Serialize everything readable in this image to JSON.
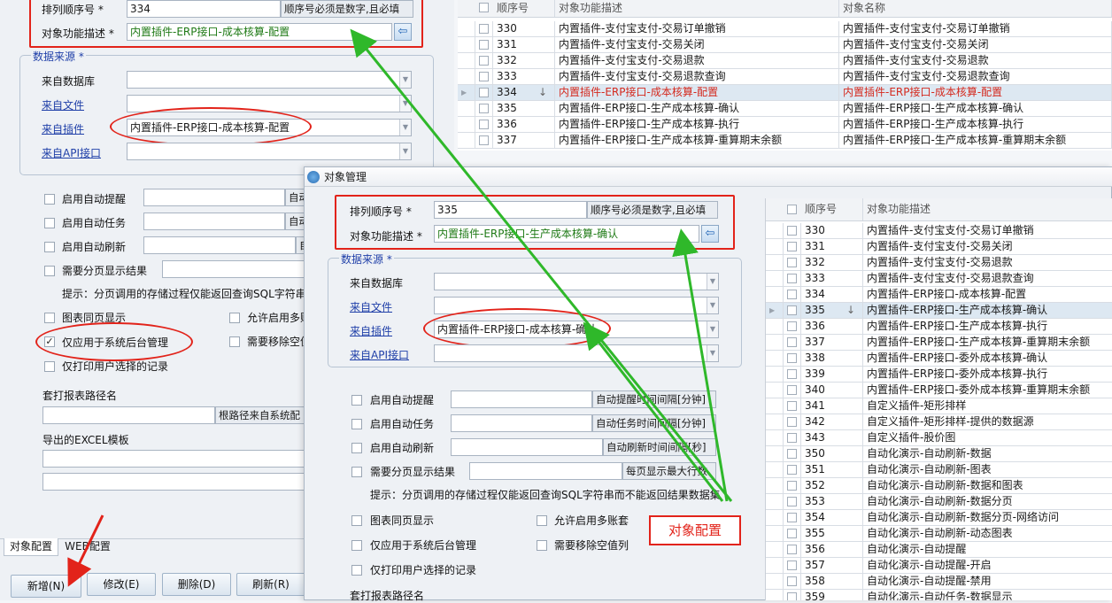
{
  "bg": {
    "order_label": "排列顺序号",
    "order_value": "334",
    "order_note": "顺序号必须是数字,且必填",
    "desc_label": "对象功能描述",
    "desc_value": "内置插件-ERP接口-成本核算-配置",
    "datasource_title": "数据来源",
    "from_db": "来自数据库",
    "from_file": "来自文件",
    "from_plugin": "来自插件",
    "plugin_value": "内置插件-ERP接口-成本核算-配置",
    "from_api": "来自API接口",
    "auto_remind": "启用自动提醒",
    "auto_remind_note": "自动",
    "auto_task": "启用自动任务",
    "auto_task_note": "自动",
    "auto_refresh": "启用自动刷新",
    "auto_refresh_note": "自",
    "paging": "需要分页显示结果",
    "hint": "提示：分页调用的存储过程仅能返回查询SQL字符串i",
    "same_page": "图表同页显示",
    "multi_acct": "允许启用多账",
    "backend_only": "仅应用于系统后台管理",
    "remove_null": "需要移除空值",
    "print_selected": "仅打印用户选择的记录",
    "print_path": "套打报表路径名",
    "root_note": "根路径来自系统配",
    "excel_template": "导出的EXCEL模板",
    "tab_object": "对象配置",
    "tab_web": "WEB配置",
    "btn_add": "新增(N)",
    "btn_edit": "修改(E)",
    "btn_delete": "删除(D)",
    "btn_refresh": "刷新(R)",
    "grid_headers": [
      "顺序号",
      "对象功能描述",
      "对象名称"
    ],
    "grid_rows": [
      [
        "330",
        "内置插件-支付宝支付-交易订单撤销",
        "内置插件-支付宝支付-交易订单撤销"
      ],
      [
        "331",
        "内置插件-支付宝支付-交易关闭",
        "内置插件-支付宝支付-交易关闭"
      ],
      [
        "332",
        "内置插件-支付宝支付-交易退款",
        "内置插件-支付宝支付-交易退款"
      ],
      [
        "333",
        "内置插件-支付宝支付-交易退款查询",
        "内置插件-支付宝支付-交易退款查询"
      ],
      [
        "334",
        "内置插件-ERP接口-成本核算-配置",
        "内置插件-ERP接口-成本核算-配置"
      ],
      [
        "335",
        "内置插件-ERP接口-生产成本核算-确认",
        "内置插件-ERP接口-生产成本核算-确认"
      ],
      [
        "336",
        "内置插件-ERP接口-生产成本核算-执行",
        "内置插件-ERP接口-生产成本核算-执行"
      ],
      [
        "337",
        "内置插件-ERP接口-生产成本核算-重算期末余额",
        "内置插件-ERP接口-生产成本核算-重算期末余额"
      ]
    ]
  },
  "fg": {
    "window_title": "对象管理",
    "order_label": "排列顺序号",
    "order_value": "335",
    "order_note": "顺序号必须是数字,且必填",
    "desc_label": "对象功能描述",
    "desc_value": "内置插件-ERP接口-生产成本核算-确认",
    "datasource_title": "数据来源",
    "from_db": "来自数据库",
    "from_file": "来自文件",
    "from_plugin": "来自插件",
    "plugin_value": "内置插件-ERP接口-成本核算-确认",
    "from_api": "来自API接口",
    "auto_remind": "启用自动提醒",
    "auto_remind_note": "自动提醒时间间隔[分钟]",
    "auto_task": "启用自动任务",
    "auto_task_note": "自动任务时间间隔[分钟]",
    "auto_refresh": "启用自动刷新",
    "auto_refresh_note": "自动刷新时间间隔[秒]",
    "paging": "需要分页显示结果",
    "paging_note": "每页显示最大行数",
    "hint": "提示：分页调用的存储过程仅能返回查询SQL字符串而不能返回结果数据集",
    "same_page": "图表同页显示",
    "multi_acct": "允许启用多账套",
    "backend_only": "仅应用于系统后台管理",
    "remove_null": "需要移除空值列",
    "print_selected": "仅打印用户选择的记录",
    "print_path": "套打报表路径名",
    "callout": "对象配置",
    "grid_headers": [
      "顺序号",
      "对象功能描述"
    ],
    "grid_rows": [
      [
        "330",
        "内置插件-支付宝支付-交易订单撤销"
      ],
      [
        "331",
        "内置插件-支付宝支付-交易关闭"
      ],
      [
        "332",
        "内置插件-支付宝支付-交易退款"
      ],
      [
        "333",
        "内置插件-支付宝支付-交易退款查询"
      ],
      [
        "334",
        "内置插件-ERP接口-成本核算-配置"
      ],
      [
        "335",
        "内置插件-ERP接口-生产成本核算-确认"
      ],
      [
        "336",
        "内置插件-ERP接口-生产成本核算-执行"
      ],
      [
        "337",
        "内置插件-ERP接口-生产成本核算-重算期末余额"
      ],
      [
        "338",
        "内置插件-ERP接口-委外成本核算-确认"
      ],
      [
        "339",
        "内置插件-ERP接口-委外成本核算-执行"
      ],
      [
        "340",
        "内置插件-ERP接口-委外成本核算-重算期末余额"
      ],
      [
        "341",
        "自定义插件-矩形排样"
      ],
      [
        "342",
        "自定义插件-矩形排样-提供的数据源"
      ],
      [
        "343",
        "自定义插件-股价图"
      ],
      [
        "350",
        "自动化演示-自动刷新-数据"
      ],
      [
        "351",
        "自动化演示-自动刷新-图表"
      ],
      [
        "352",
        "自动化演示-自动刷新-数据和图表"
      ],
      [
        "353",
        "自动化演示-自动刷新-数据分页"
      ],
      [
        "354",
        "自动化演示-自动刷新-数据分页-网络访问"
      ],
      [
        "355",
        "自动化演示-自动刷新-动态图表"
      ],
      [
        "356",
        "自动化演示-自动提醒"
      ],
      [
        "357",
        "自动化演示-自动提醒-开启"
      ],
      [
        "358",
        "自动化演示-自动提醒-禁用"
      ],
      [
        "359",
        "自动化演示-自动任务-数据显示"
      ]
    ]
  },
  "colors": {
    "annotation_red": "#e2231a",
    "annotation_green": "#2fb82a",
    "link_blue": "#1f3fa8",
    "value_green": "#1f7a16"
  }
}
